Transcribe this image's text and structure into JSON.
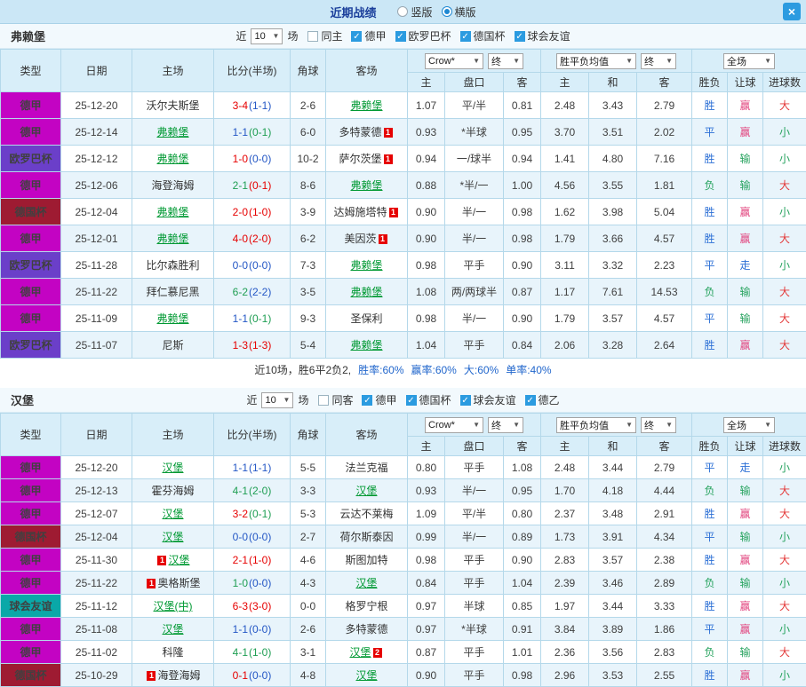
{
  "header": {
    "title": "近期战绩",
    "radio_vertical": "竖版",
    "radio_horizontal": "横版",
    "close_label": "×"
  },
  "controls": {
    "near": "近",
    "count": "10",
    "matches": "场",
    "bookmaker": "Crow*",
    "final": "终",
    "odds_avg": "胜平负均值",
    "scope": "全场"
  },
  "columns": {
    "type": "类型",
    "date": "日期",
    "home": "主场",
    "score": "比分(半场)",
    "corner": "角球",
    "away": "客场",
    "asia_home": "主",
    "handicap": "盘口",
    "asia_away": "客",
    "eu_home": "主",
    "eu_draw": "和",
    "eu_away": "客",
    "result": "胜负",
    "handicap_result": "让球",
    "goals": "进球数"
  },
  "colors": {
    "league": {
      "德甲": "#c303c3",
      "欧罗巴杯": "#6b3fc9",
      "德国杯": "#9e1b32",
      "球会友谊": "#0aa8a8",
      "德乙": "#c303c3"
    },
    "score": {
      "w": "#e60000",
      "d": "#2457c5",
      "l": "#1f9e53"
    },
    "text": {
      "胜": "#2b6fd6",
      "平": "#2b6fd6",
      "负": "#27a35f",
      "赢": "#e2447e",
      "走": "#2b6fd6",
      "输": "#27a35f",
      "大": "#e43a3a",
      "小": "#27a35f"
    }
  },
  "sections": [
    {
      "team": "弗赖堡",
      "filters": [
        {
          "label": "同主",
          "checked": false
        },
        {
          "label": "德甲",
          "checked": true
        },
        {
          "label": "欧罗巴杯",
          "checked": true
        },
        {
          "label": "德国杯",
          "checked": true
        },
        {
          "label": "球会友谊",
          "checked": true
        }
      ],
      "rows": [
        {
          "league": "德甲",
          "date": "25-12-20",
          "home": {
            "name": "沃尔夫斯堡"
          },
          "score": {
            "ft": "3-4",
            "ftc": "w",
            "ht": "(1-1)",
            "htc": "d"
          },
          "corner": "2-6",
          "away": {
            "name": "弗赖堡",
            "focus": true
          },
          "asia": [
            "1.07",
            "平/半",
            "0.81"
          ],
          "eu": [
            "2.48",
            "3.43",
            "2.79"
          ],
          "wdl": "胜",
          "rq": "赢",
          "dx": "大"
        },
        {
          "league": "德甲",
          "date": "25-12-14",
          "home": {
            "name": "弗赖堡",
            "focus": true
          },
          "score": {
            "ft": "1-1",
            "ftc": "d",
            "ht": "(0-1)",
            "htc": "l"
          },
          "corner": "6-0",
          "away": {
            "name": "多特蒙德",
            "card": "1",
            "card_pos": "after"
          },
          "asia": [
            "0.93",
            "*半球",
            "0.95"
          ],
          "eu": [
            "3.70",
            "3.51",
            "2.02"
          ],
          "wdl": "平",
          "rq": "赢",
          "dx": "小"
        },
        {
          "league": "欧罗巴杯",
          "date": "25-12-12",
          "home": {
            "name": "弗赖堡",
            "focus": true
          },
          "score": {
            "ft": "1-0",
            "ftc": "w",
            "ht": "(0-0)",
            "htc": "d"
          },
          "corner": "10-2",
          "away": {
            "name": "萨尔茨堡",
            "card": "1",
            "card_pos": "after"
          },
          "asia": [
            "0.94",
            "一/球半",
            "0.94"
          ],
          "eu": [
            "1.41",
            "4.80",
            "7.16"
          ],
          "wdl": "胜",
          "rq": "输",
          "dx": "小"
        },
        {
          "league": "德甲",
          "date": "25-12-06",
          "home": {
            "name": "海登海姆"
          },
          "score": {
            "ft": "2-1",
            "ftc": "l",
            "ht": "(0-1)",
            "htc": "w"
          },
          "corner": "8-6",
          "away": {
            "name": "弗赖堡",
            "focus": true
          },
          "asia": [
            "0.88",
            "*半/一",
            "1.00"
          ],
          "eu": [
            "4.56",
            "3.55",
            "1.81"
          ],
          "wdl": "负",
          "rq": "输",
          "dx": "大"
        },
        {
          "league": "德国杯",
          "date": "25-12-04",
          "home": {
            "name": "弗赖堡",
            "focus": true
          },
          "score": {
            "ft": "2-0",
            "ftc": "w",
            "ht": "(1-0)",
            "htc": "w"
          },
          "corner": "3-9",
          "away": {
            "name": "达姆施塔特",
            "card": "1",
            "card_pos": "after"
          },
          "asia": [
            "0.90",
            "半/一",
            "0.98"
          ],
          "eu": [
            "1.62",
            "3.98",
            "5.04"
          ],
          "wdl": "胜",
          "rq": "赢",
          "dx": "小"
        },
        {
          "league": "德甲",
          "date": "25-12-01",
          "home": {
            "name": "弗赖堡",
            "focus": true
          },
          "score": {
            "ft": "4-0",
            "ftc": "w",
            "ht": "(2-0)",
            "htc": "w"
          },
          "corner": "6-2",
          "away": {
            "name": "美因茨",
            "card": "1",
            "card_pos": "after"
          },
          "asia": [
            "0.90",
            "半/一",
            "0.98"
          ],
          "eu": [
            "1.79",
            "3.66",
            "4.57"
          ],
          "wdl": "胜",
          "rq": "赢",
          "dx": "大"
        },
        {
          "league": "欧罗巴杯",
          "date": "25-11-28",
          "home": {
            "name": "比尔森胜利"
          },
          "score": {
            "ft": "0-0",
            "ftc": "d",
            "ht": "(0-0)",
            "htc": "d"
          },
          "corner": "7-3",
          "away": {
            "name": "弗赖堡",
            "focus": true
          },
          "asia": [
            "0.98",
            "平手",
            "0.90"
          ],
          "eu": [
            "3.11",
            "3.32",
            "2.23"
          ],
          "wdl": "平",
          "rq": "走",
          "dx": "小"
        },
        {
          "league": "德甲",
          "date": "25-11-22",
          "home": {
            "name": "拜仁慕尼黑"
          },
          "score": {
            "ft": "6-2",
            "ftc": "l",
            "ht": "(2-2)",
            "htc": "d"
          },
          "corner": "3-5",
          "away": {
            "name": "弗赖堡",
            "focus": true
          },
          "asia": [
            "1.08",
            "两/两球半",
            "0.87"
          ],
          "eu": [
            "1.17",
            "7.61",
            "14.53"
          ],
          "wdl": "负",
          "rq": "输",
          "dx": "大"
        },
        {
          "league": "德甲",
          "date": "25-11-09",
          "home": {
            "name": "弗赖堡",
            "focus": true
          },
          "score": {
            "ft": "1-1",
            "ftc": "d",
            "ht": "(0-1)",
            "htc": "l"
          },
          "corner": "9-3",
          "away": {
            "name": "圣保利"
          },
          "asia": [
            "0.98",
            "半/一",
            "0.90"
          ],
          "eu": [
            "1.79",
            "3.57",
            "4.57"
          ],
          "wdl": "平",
          "rq": "输",
          "dx": "大"
        },
        {
          "league": "欧罗巴杯",
          "date": "25-11-07",
          "home": {
            "name": "尼斯"
          },
          "score": {
            "ft": "1-3",
            "ftc": "w",
            "ht": "(1-3)",
            "htc": "w"
          },
          "corner": "5-4",
          "away": {
            "name": "弗赖堡",
            "focus": true
          },
          "asia": [
            "1.04",
            "平手",
            "0.84"
          ],
          "eu": [
            "2.06",
            "3.28",
            "2.64"
          ],
          "wdl": "胜",
          "rq": "赢",
          "dx": "大"
        }
      ],
      "summary": [
        {
          "text": "近10场，胜6平2负2,",
          "color": "#333333"
        },
        {
          "text": "胜率:60%",
          "color": "#2166cc"
        },
        {
          "text": "赢率:60%",
          "color": "#2166cc"
        },
        {
          "text": "大:60%",
          "color": "#2166cc"
        },
        {
          "text": "单率:40%",
          "color": "#2166cc"
        }
      ]
    },
    {
      "team": "汉堡",
      "filters": [
        {
          "label": "同客",
          "checked": false
        },
        {
          "label": "德甲",
          "checked": true
        },
        {
          "label": "德国杯",
          "checked": true
        },
        {
          "label": "球会友谊",
          "checked": true
        },
        {
          "label": "德乙",
          "checked": true
        }
      ],
      "rows": [
        {
          "league": "德甲",
          "date": "25-12-20",
          "home": {
            "name": "汉堡",
            "focus": true
          },
          "score": {
            "ft": "1-1",
            "ftc": "d",
            "ht": "(1-1)",
            "htc": "d"
          },
          "corner": "5-5",
          "away": {
            "name": "法兰克福"
          },
          "asia": [
            "0.80",
            "平手",
            "1.08"
          ],
          "eu": [
            "2.48",
            "3.44",
            "2.79"
          ],
          "wdl": "平",
          "rq": "走",
          "dx": "小"
        },
        {
          "league": "德甲",
          "date": "25-12-13",
          "home": {
            "name": "霍芬海姆"
          },
          "score": {
            "ft": "4-1",
            "ftc": "l",
            "ht": "(2-0)",
            "htc": "l"
          },
          "corner": "3-3",
          "away": {
            "name": "汉堡",
            "focus": true
          },
          "asia": [
            "0.93",
            "半/一",
            "0.95"
          ],
          "eu": [
            "1.70",
            "4.18",
            "4.44"
          ],
          "wdl": "负",
          "rq": "输",
          "dx": "大"
        },
        {
          "league": "德甲",
          "date": "25-12-07",
          "home": {
            "name": "汉堡",
            "focus": true
          },
          "score": {
            "ft": "3-2",
            "ftc": "w",
            "ht": "(0-1)",
            "htc": "l"
          },
          "corner": "5-3",
          "away": {
            "name": "云达不莱梅"
          },
          "asia": [
            "1.09",
            "平/半",
            "0.80"
          ],
          "eu": [
            "2.37",
            "3.48",
            "2.91"
          ],
          "wdl": "胜",
          "rq": "赢",
          "dx": "大"
        },
        {
          "league": "德国杯",
          "date": "25-12-04",
          "home": {
            "name": "汉堡",
            "focus": true
          },
          "score": {
            "ft": "0-0",
            "ftc": "d",
            "ht": "(0-0)",
            "htc": "d"
          },
          "corner": "2-7",
          "away": {
            "name": "荷尔斯泰因"
          },
          "asia": [
            "0.99",
            "半/一",
            "0.89"
          ],
          "eu": [
            "1.73",
            "3.91",
            "4.34"
          ],
          "wdl": "平",
          "rq": "输",
          "dx": "小"
        },
        {
          "league": "德甲",
          "date": "25-11-30",
          "home": {
            "name": "汉堡",
            "focus": true,
            "card": "1",
            "card_pos": "before"
          },
          "score": {
            "ft": "2-1",
            "ftc": "w",
            "ht": "(1-0)",
            "htc": "w"
          },
          "corner": "4-6",
          "away": {
            "name": "斯图加特"
          },
          "asia": [
            "0.98",
            "平手",
            "0.90"
          ],
          "eu": [
            "2.83",
            "3.57",
            "2.38"
          ],
          "wdl": "胜",
          "rq": "赢",
          "dx": "大"
        },
        {
          "league": "德甲",
          "date": "25-11-22",
          "home": {
            "name": "奥格斯堡",
            "card": "1",
            "card_pos": "before"
          },
          "score": {
            "ft": "1-0",
            "ftc": "l",
            "ht": "(0-0)",
            "htc": "d"
          },
          "corner": "4-3",
          "away": {
            "name": "汉堡",
            "focus": true
          },
          "asia": [
            "0.84",
            "平手",
            "1.04"
          ],
          "eu": [
            "2.39",
            "3.46",
            "2.89"
          ],
          "wdl": "负",
          "rq": "输",
          "dx": "小"
        },
        {
          "league": "球会友谊",
          "date": "25-11-12",
          "home": {
            "name": "汉堡(中)",
            "focus": true
          },
          "score": {
            "ft": "6-3",
            "ftc": "w",
            "ht": "(3-0)",
            "htc": "w"
          },
          "corner": "0-0",
          "away": {
            "name": "格罗宁根"
          },
          "asia": [
            "0.97",
            "半球",
            "0.85"
          ],
          "eu": [
            "1.97",
            "3.44",
            "3.33"
          ],
          "wdl": "胜",
          "rq": "赢",
          "dx": "大"
        },
        {
          "league": "德甲",
          "date": "25-11-08",
          "home": {
            "name": "汉堡",
            "focus": true
          },
          "score": {
            "ft": "1-1",
            "ftc": "d",
            "ht": "(0-0)",
            "htc": "d"
          },
          "corner": "2-6",
          "away": {
            "name": "多特蒙德"
          },
          "asia": [
            "0.97",
            "*半球",
            "0.91"
          ],
          "eu": [
            "3.84",
            "3.89",
            "1.86"
          ],
          "wdl": "平",
          "rq": "赢",
          "dx": "小"
        },
        {
          "league": "德甲",
          "date": "25-11-02",
          "home": {
            "name": "科隆"
          },
          "score": {
            "ft": "4-1",
            "ftc": "l",
            "ht": "(1-0)",
            "htc": "l"
          },
          "corner": "3-1",
          "away": {
            "name": "汉堡",
            "focus": true,
            "card": "2",
            "card_pos": "after"
          },
          "asia": [
            "0.87",
            "平手",
            "1.01"
          ],
          "eu": [
            "2.36",
            "3.56",
            "2.83"
          ],
          "wdl": "负",
          "rq": "输",
          "dx": "大"
        },
        {
          "league": "德国杯",
          "date": "25-10-29",
          "home": {
            "name": "海登海姆",
            "card": "1",
            "card_pos": "before"
          },
          "score": {
            "ft": "0-1",
            "ftc": "w",
            "ht": "(0-0)",
            "htc": "d"
          },
          "corner": "4-8",
          "away": {
            "name": "汉堡",
            "focus": true
          },
          "asia": [
            "0.90",
            "平手",
            "0.98"
          ],
          "eu": [
            "2.96",
            "3.53",
            "2.55"
          ],
          "wdl": "胜",
          "rq": "赢",
          "dx": "小"
        }
      ]
    }
  ]
}
